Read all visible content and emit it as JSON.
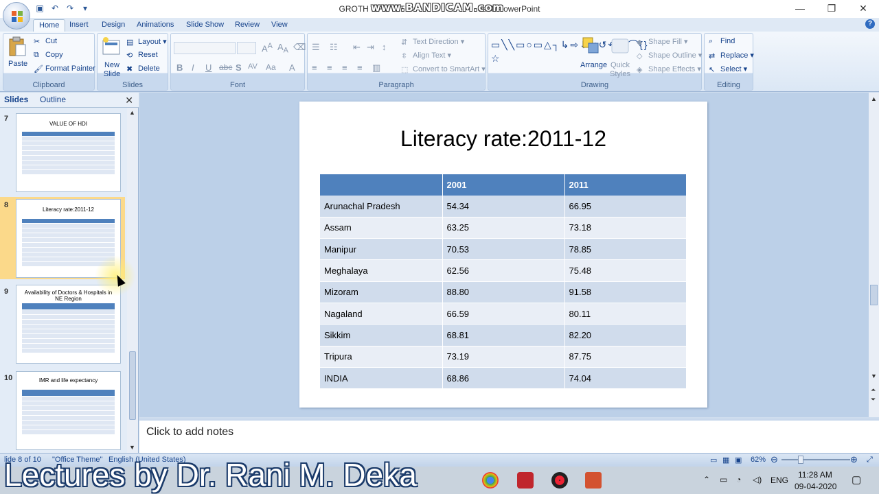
{
  "window": {
    "title": "GROTH OF STAT",
    "title_suffix": "osoft PowerPoint",
    "recorder_watermark": "www.BANDICAM.com"
  },
  "tabs": [
    "Home",
    "Insert",
    "Design",
    "Animations",
    "Slide Show",
    "Review",
    "View"
  ],
  "ribbon": {
    "clipboard": {
      "label": "Clipboard",
      "paste": "Paste",
      "cut": "Cut",
      "copy": "Copy",
      "format_painter": "Format Painter"
    },
    "slides": {
      "label": "Slides",
      "new_slide": "New Slide",
      "layout": "Layout",
      "reset": "Reset",
      "delete": "Delete"
    },
    "font": {
      "label": "Font"
    },
    "paragraph": {
      "label": "Paragraph",
      "text_direction": "Text Direction",
      "align_text": "Align Text",
      "convert_smartart": "Convert to SmartArt"
    },
    "drawing": {
      "label": "Drawing",
      "arrange": "Arrange",
      "quick_styles": "Quick Styles",
      "shape_fill": "Shape Fill",
      "shape_outline": "Shape Outline",
      "shape_effects": "Shape Effects"
    },
    "editing": {
      "label": "Editing",
      "find": "Find",
      "replace": "Replace",
      "select": "Select"
    }
  },
  "panel": {
    "tabs": [
      "Slides",
      "Outline"
    ],
    "thumbnails": [
      {
        "num": "7",
        "title": "VALUE OF HDI"
      },
      {
        "num": "8",
        "title": "Literacy rate:2011-12"
      },
      {
        "num": "9",
        "title": "Availability of Doctors & Hospitals in NE Region"
      },
      {
        "num": "10",
        "title": "IMR and life expectancy"
      }
    ]
  },
  "slide": {
    "title": "Literacy rate:2011-12",
    "headers": [
      "",
      "2001",
      "2011"
    ],
    "rows": [
      [
        "Arunachal Pradesh",
        "54.34",
        "66.95"
      ],
      [
        "Assam",
        "63.25",
        "73.18"
      ],
      [
        "Manipur",
        "70.53",
        "78.85"
      ],
      [
        "Meghalaya",
        "62.56",
        "75.48"
      ],
      [
        "Mizoram",
        "88.80",
        "91.58"
      ],
      [
        "Nagaland",
        "66.59",
        "80.11"
      ],
      [
        "Sikkim",
        "68.81",
        "82.20"
      ],
      [
        "Tripura",
        "73.19",
        "87.75"
      ],
      [
        "INDIA",
        "68.86",
        "74.04"
      ]
    ]
  },
  "notes": {
    "placeholder": "Click to add notes"
  },
  "status": {
    "slide_info": "lide 8 of 10",
    "theme": "\"Office Theme\"",
    "language": "English (United States)",
    "zoom": "62%"
  },
  "taskbar": {
    "watermark": "Lectures by Dr. Rani M. Deka",
    "lang": "ENG",
    "time": "11:28 AM",
    "date": "09-04-2020"
  },
  "colors": {
    "table_header": "#4f81bd",
    "ribbon_text": "#15428b",
    "selected_thumb": "#fbd98a"
  }
}
